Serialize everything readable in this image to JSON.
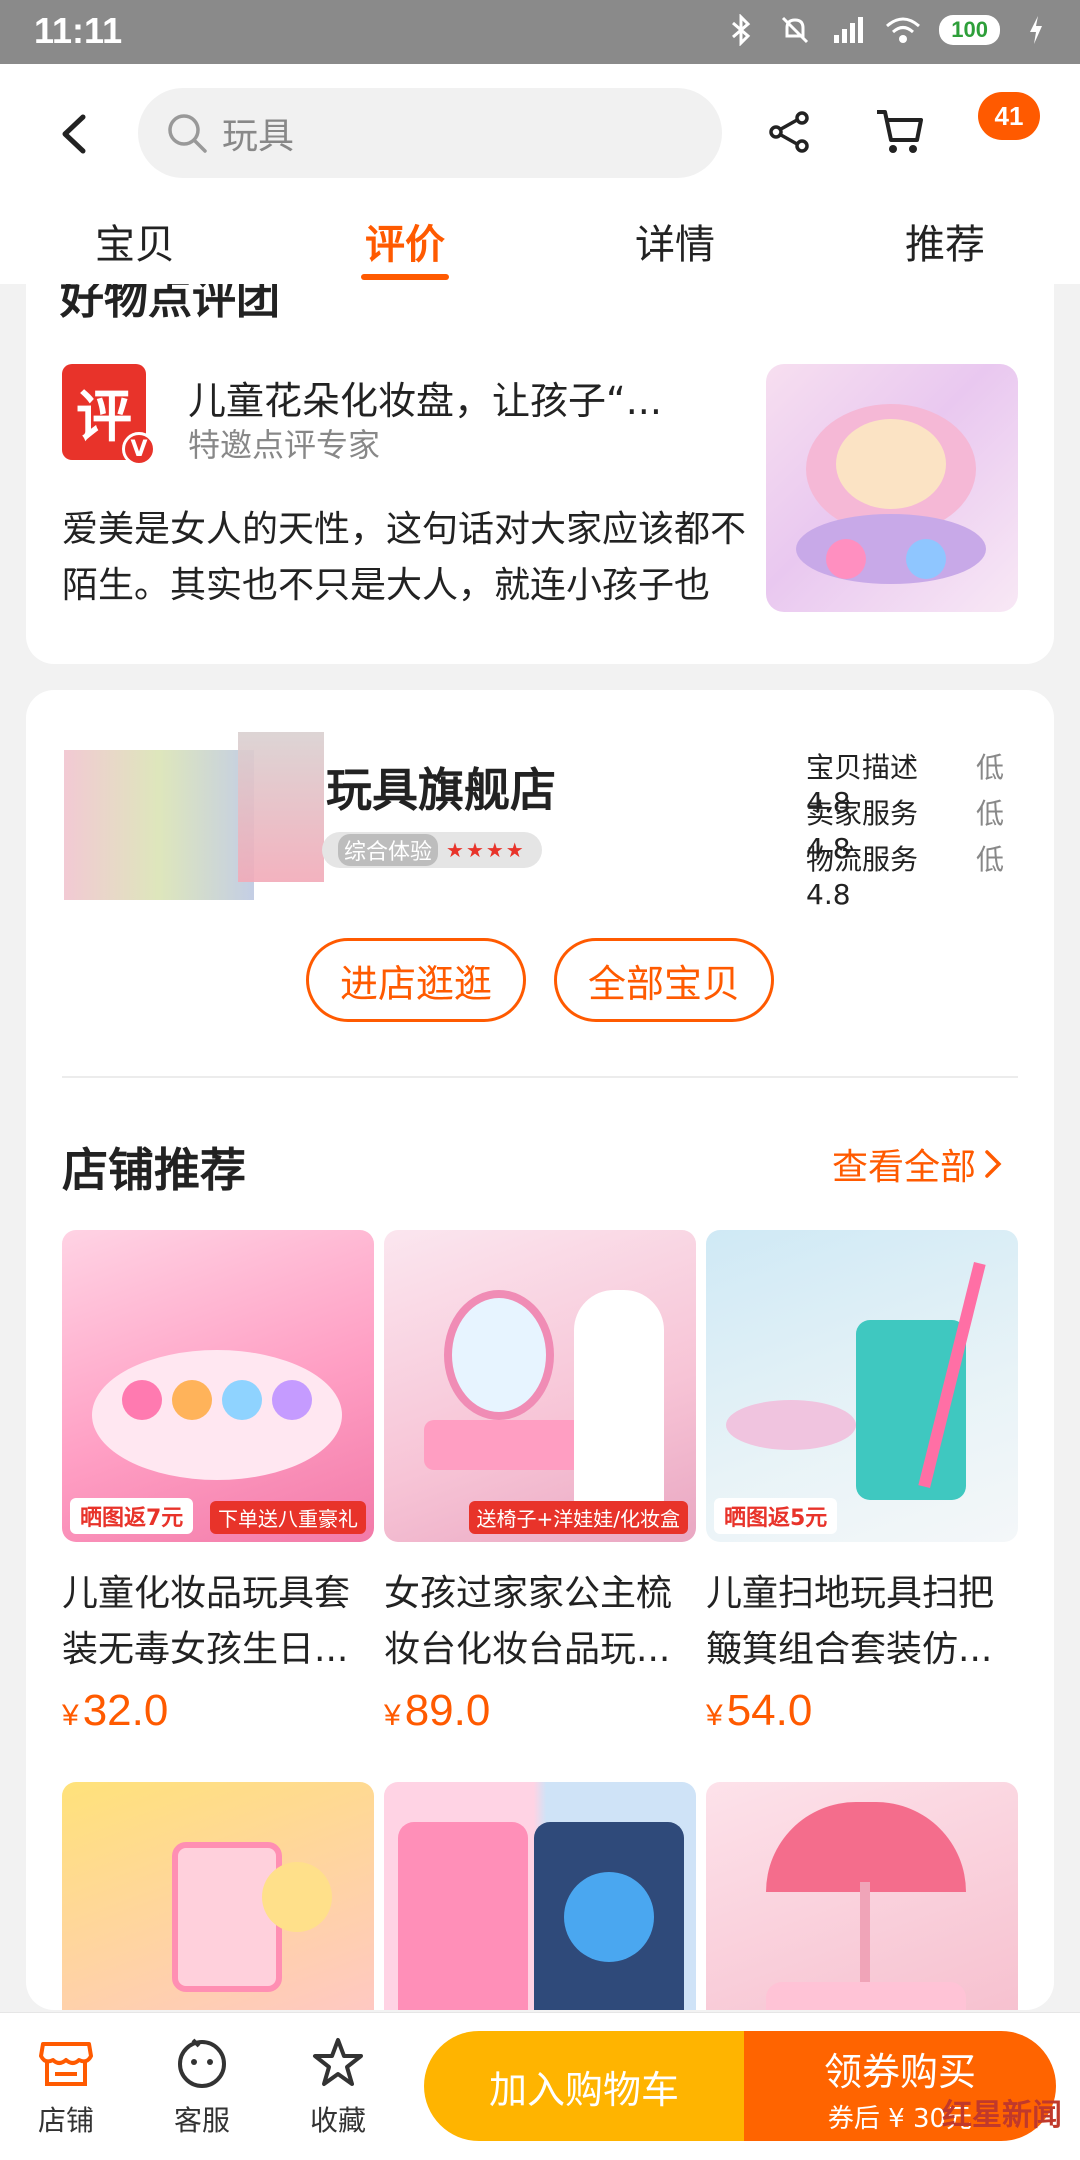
{
  "status_bar": {
    "time": "11:11",
    "battery": "100"
  },
  "search": {
    "placeholder": "玩具"
  },
  "cart_badge": "41",
  "tabs": [
    {
      "label": "宝贝",
      "active": false
    },
    {
      "label": "评价",
      "active": true
    },
    {
      "label": "详情",
      "active": false
    },
    {
      "label": "推荐",
      "active": false
    }
  ],
  "review": {
    "section_title": "好物点评团",
    "logo_char": "评",
    "logo_badge": "V",
    "title": "儿童花朵化妆盘，让孩子“...",
    "subtitle": "特邀点评专家",
    "body": "爱美是女人的天性，这句话对大家应该都不陌生。其实也不只是大人，就连小孩子也"
  },
  "shop": {
    "name": "玩具旗舰店",
    "experience_label": "综合体验",
    "experience_stars": "★★★★",
    "scores": [
      {
        "label": "宝贝描述 4.8",
        "level": "低"
      },
      {
        "label": "卖家服务 4.8",
        "level": "低"
      },
      {
        "label": "物流服务 4.8",
        "level": "低"
      }
    ],
    "enter_button": "进店逛逛",
    "all_button": "全部宝贝"
  },
  "recommend": {
    "title": "店铺推荐",
    "more": "查看全部",
    "products": [
      {
        "name": "儿童化妆品玩具套装无毒女孩生日...",
        "price": "32.0",
        "tag": "晒图返7元",
        "tag2": "下单送八重豪礼"
      },
      {
        "name": "女孩过家家公主梳妆台化妆台品玩...",
        "price": "89.0",
        "tag": "",
        "tag2": "送椅子+洋娃娃/化妆盒"
      },
      {
        "name": "儿童扫地玩具扫把簸箕组合套装仿...",
        "price": "54.0",
        "tag": "晒图返5元",
        "tag2": ""
      }
    ]
  },
  "bottom_bar": {
    "shop_label": "店铺",
    "service_label": "客服",
    "favorite_label": "收藏",
    "add_cart": "加入购物车",
    "buy_main": "领券购买",
    "buy_sub": "券后 ¥ 30元"
  },
  "currency": "¥",
  "colors": {
    "accent": "#ff5a00",
    "cart_button": "#ffb400",
    "buy_button": "#ff6400"
  },
  "watermark": "红星新闻"
}
